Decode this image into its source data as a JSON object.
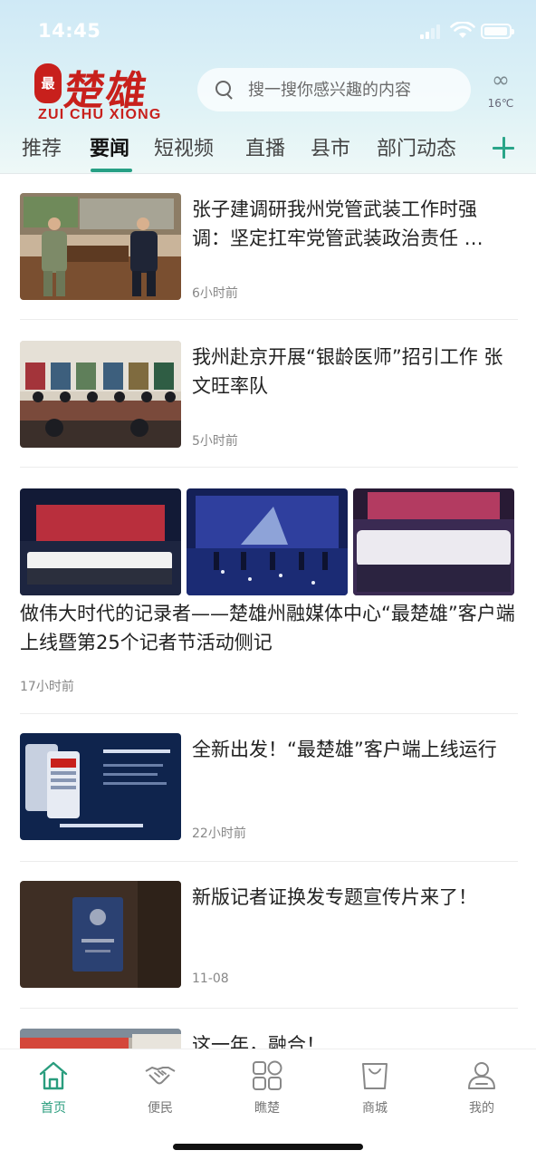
{
  "status_bar": {
    "time": "14:45"
  },
  "header": {
    "logo_seal": "最",
    "logo_text": "楚雄",
    "logo_pinyin": "ZUI CHU XIONG",
    "search_placeholder": "搜一搜你感兴趣的内容",
    "weather_icon": "∞",
    "temperature": "16℃"
  },
  "tabs": [
    {
      "label": "推荐"
    },
    {
      "label": "要闻",
      "active": true
    },
    {
      "label": "短视频"
    },
    {
      "label": "直播"
    },
    {
      "label": "县市"
    },
    {
      "label": "部门动态"
    }
  ],
  "feed": [
    {
      "title": "张子建调研我州党管武装工作时强调：坚定扛牢党管武装政治责任 …",
      "time": "6小时前",
      "thumb_colors": [
        "#7d8a68",
        "#5e4a3c",
        "#c9b49a"
      ]
    },
    {
      "title": "我州赴京开展“银龄医师”招引工作 张文旺率队",
      "time": "5小时前",
      "thumb_colors": [
        "#7a4a3b",
        "#d8d0c2",
        "#3d5f7d"
      ]
    },
    {
      "title": "做伟大时代的记录者——楚雄州融媒体中心“最楚雄”客户端上线暨第25个记者节活动侧记",
      "time": "17小时前",
      "thumb_colors": [
        "#b92f3d",
        "#2f3f9e",
        "#b33b61"
      ]
    },
    {
      "title": "全新出发！“最楚雄”客户端上线运行",
      "time": "22小时前",
      "thumb_colors": [
        "#0f244d",
        "#c7d0e0"
      ]
    },
    {
      "title": "新版记者证换发专题宣传片来了！",
      "time": "11-08",
      "thumb_colors": [
        "#3e2e24",
        "#2b4172"
      ]
    },
    {
      "title": "这一年，融合！",
      "time": "",
      "thumb_colors": [
        "#d4473a",
        "#b9b2a8"
      ]
    }
  ],
  "bottom_nav": [
    {
      "label": "首页",
      "icon": "home-icon",
      "active": true
    },
    {
      "label": "便民",
      "icon": "handshake-icon"
    },
    {
      "label": "瞧楚",
      "icon": "grid-icon"
    },
    {
      "label": "商城",
      "icon": "shopping-bag-icon"
    },
    {
      "label": "我的",
      "icon": "user-icon"
    }
  ],
  "colors": {
    "accent": "#2aa589",
    "brand_red": "#c8201c"
  }
}
